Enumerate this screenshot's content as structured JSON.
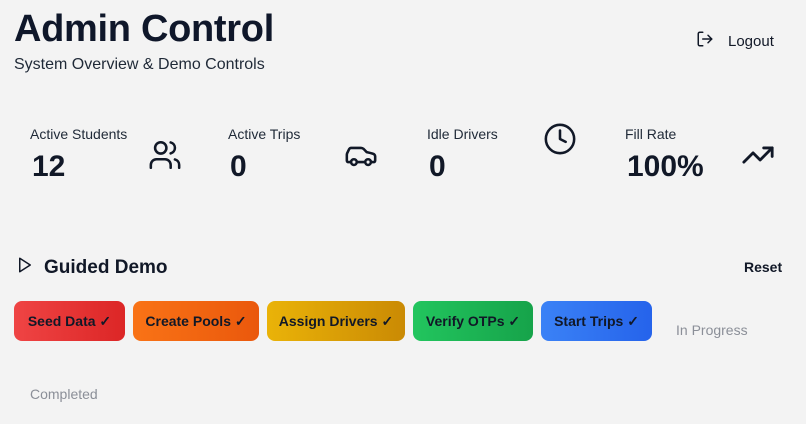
{
  "header": {
    "title": "Admin Control",
    "subtitle": "System Overview & Demo Controls",
    "logout_label": "Logout",
    "logout_icon": "logout-icon"
  },
  "stats": [
    {
      "label": "Active Students",
      "value": "12",
      "icon": "users-icon"
    },
    {
      "label": "Active Trips",
      "value": "0",
      "icon": "car-icon"
    },
    {
      "label": "Idle Drivers",
      "value": "0",
      "icon": "clock-icon"
    },
    {
      "label": "Fill Rate",
      "value": "100%",
      "icon": "trending-up-icon"
    }
  ],
  "demo": {
    "title": "Guided Demo",
    "title_icon": "play-icon",
    "reset_label": "Reset",
    "steps": [
      {
        "label": "Seed Data ✓",
        "colors": [
          "#ef4444",
          "#dc2626"
        ]
      },
      {
        "label": "Create Pools ✓",
        "colors": [
          "#f97316",
          "#ea580c"
        ]
      },
      {
        "label": "Assign Drivers ✓",
        "colors": [
          "#eab308",
          "#ca8a04"
        ]
      },
      {
        "label": "Verify OTPs ✓",
        "colors": [
          "#22c55e",
          "#16a34a"
        ]
      },
      {
        "label": "Start Trips ✓",
        "colors": [
          "#3b82f6",
          "#2563eb"
        ]
      }
    ],
    "in_progress_label": "In Progress",
    "completed_label": "Completed"
  }
}
